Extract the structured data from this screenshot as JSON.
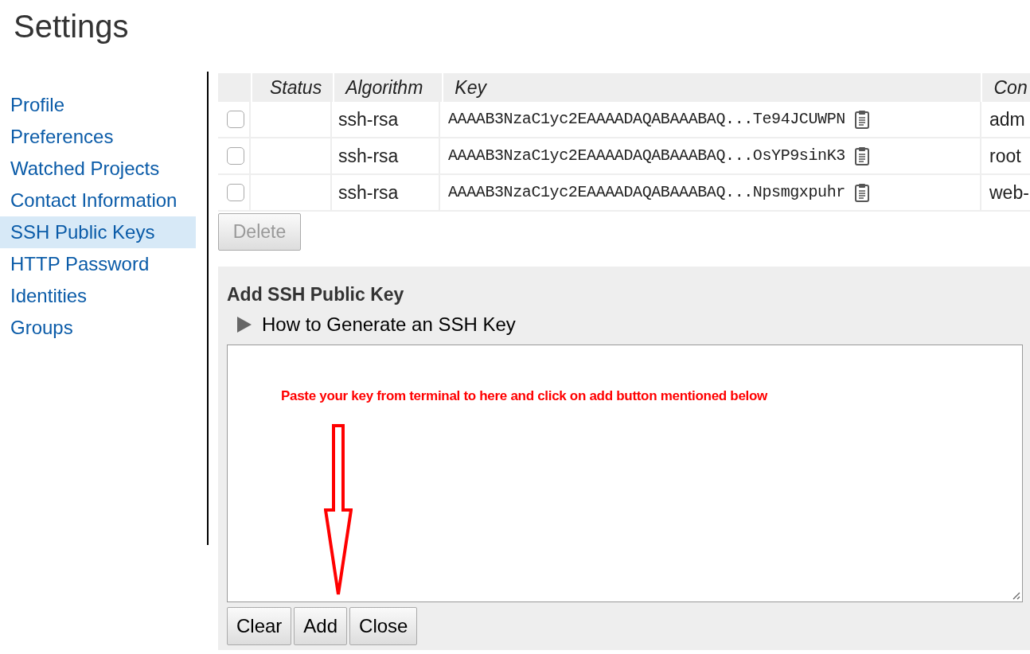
{
  "title": "Settings",
  "nav": [
    {
      "label": "Profile",
      "selected": false
    },
    {
      "label": "Preferences",
      "selected": false
    },
    {
      "label": "Watched Projects",
      "selected": false
    },
    {
      "label": "Contact Information",
      "selected": false
    },
    {
      "label": "SSH Public Keys",
      "selected": true
    },
    {
      "label": "HTTP Password",
      "selected": false
    },
    {
      "label": "Identities",
      "selected": false
    },
    {
      "label": "Groups",
      "selected": false
    }
  ],
  "table": {
    "columns": [
      "Status",
      "Algorithm",
      "Key",
      "Con"
    ],
    "rows": [
      {
        "checked": false,
        "algorithm": "ssh-rsa",
        "key": "AAAAB3NzaC1yc2EAAAADAQABAAABAQ...Te94JCUWPN",
        "comment": "adm"
      },
      {
        "checked": false,
        "algorithm": "ssh-rsa",
        "key": "AAAAB3NzaC1yc2EAAAADAQABAAABAQ...OsYP9sinK3",
        "comment": "root"
      },
      {
        "checked": false,
        "algorithm": "ssh-rsa",
        "key": "AAAAB3NzaC1yc2EAAAADAQABAAABAQ...Npsmgxpuhr",
        "comment": "web-"
      }
    ]
  },
  "delete_button": {
    "label": "Delete",
    "disabled": true
  },
  "add_panel": {
    "heading": "Add SSH Public Key",
    "disclosure": {
      "label": "How to Generate an SSH Key",
      "expanded": false
    },
    "annotation": "Paste your key from terminal to here and click on add button mentioned below",
    "buttons": [
      "Clear",
      "Add",
      "Close"
    ]
  }
}
